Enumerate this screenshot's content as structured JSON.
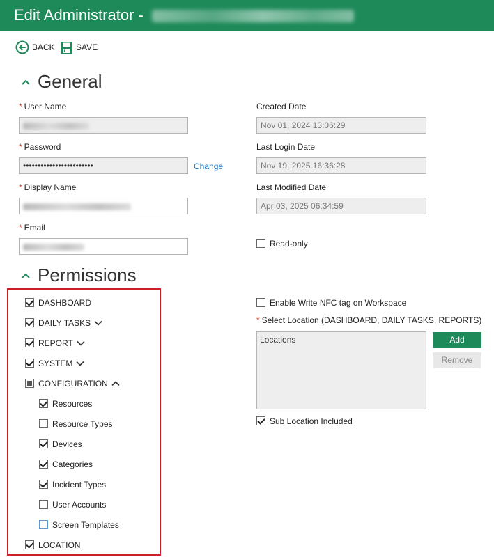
{
  "window": {
    "title": "Edit Administrator - ",
    "accent_color": "#1e8a5a"
  },
  "toolbar": {
    "back_label": "BACK",
    "save_label": "SAVE"
  },
  "general": {
    "heading": "General",
    "user_name_label": "User Name",
    "password_label": "Password",
    "password_value": "••••••••••••••••••••••••",
    "change_link": "Change",
    "display_name_label": "Display Name",
    "email_label": "Email",
    "created_date_label": "Created Date",
    "created_date_value": "Nov 01, 2024 13:06:29",
    "last_login_label": "Last Login Date",
    "last_login_value": "Nov 19, 2025 16:36:28",
    "last_modified_label": "Last Modified Date",
    "last_modified_value": "Apr 03, 2025 06:34:59",
    "readonly_label": "Read-only",
    "required_marker": "*"
  },
  "permissions": {
    "heading": "Permissions",
    "items": [
      {
        "label": "DASHBOARD",
        "state": "checked"
      },
      {
        "label": "DAILY TASKS",
        "state": "checked",
        "caret": "down"
      },
      {
        "label": "REPORT",
        "state": "checked",
        "caret": "down"
      },
      {
        "label": "SYSTEM",
        "state": "checked",
        "caret": "down"
      },
      {
        "label": "CONFIGURATION",
        "state": "partial",
        "caret": "up"
      },
      {
        "label": "Resources",
        "state": "checked"
      },
      {
        "label": "Resource Types",
        "state": "unchecked"
      },
      {
        "label": "Devices",
        "state": "checked"
      },
      {
        "label": "Categories",
        "state": "checked"
      },
      {
        "label": "Incident Types",
        "state": "checked"
      },
      {
        "label": "User Accounts",
        "state": "unchecked"
      },
      {
        "label": "Screen Templates",
        "state": "unchecked"
      },
      {
        "label": "LOCATION",
        "state": "checked"
      }
    ],
    "nfc_label": "Enable Write NFC tag on Workspace",
    "select_location_label": "Select Location (DASHBOARD, DAILY TASKS, REPORTS)",
    "locations_header": "Locations",
    "add_label": "Add",
    "remove_label": "Remove",
    "sub_location_label": "Sub Location Included"
  }
}
